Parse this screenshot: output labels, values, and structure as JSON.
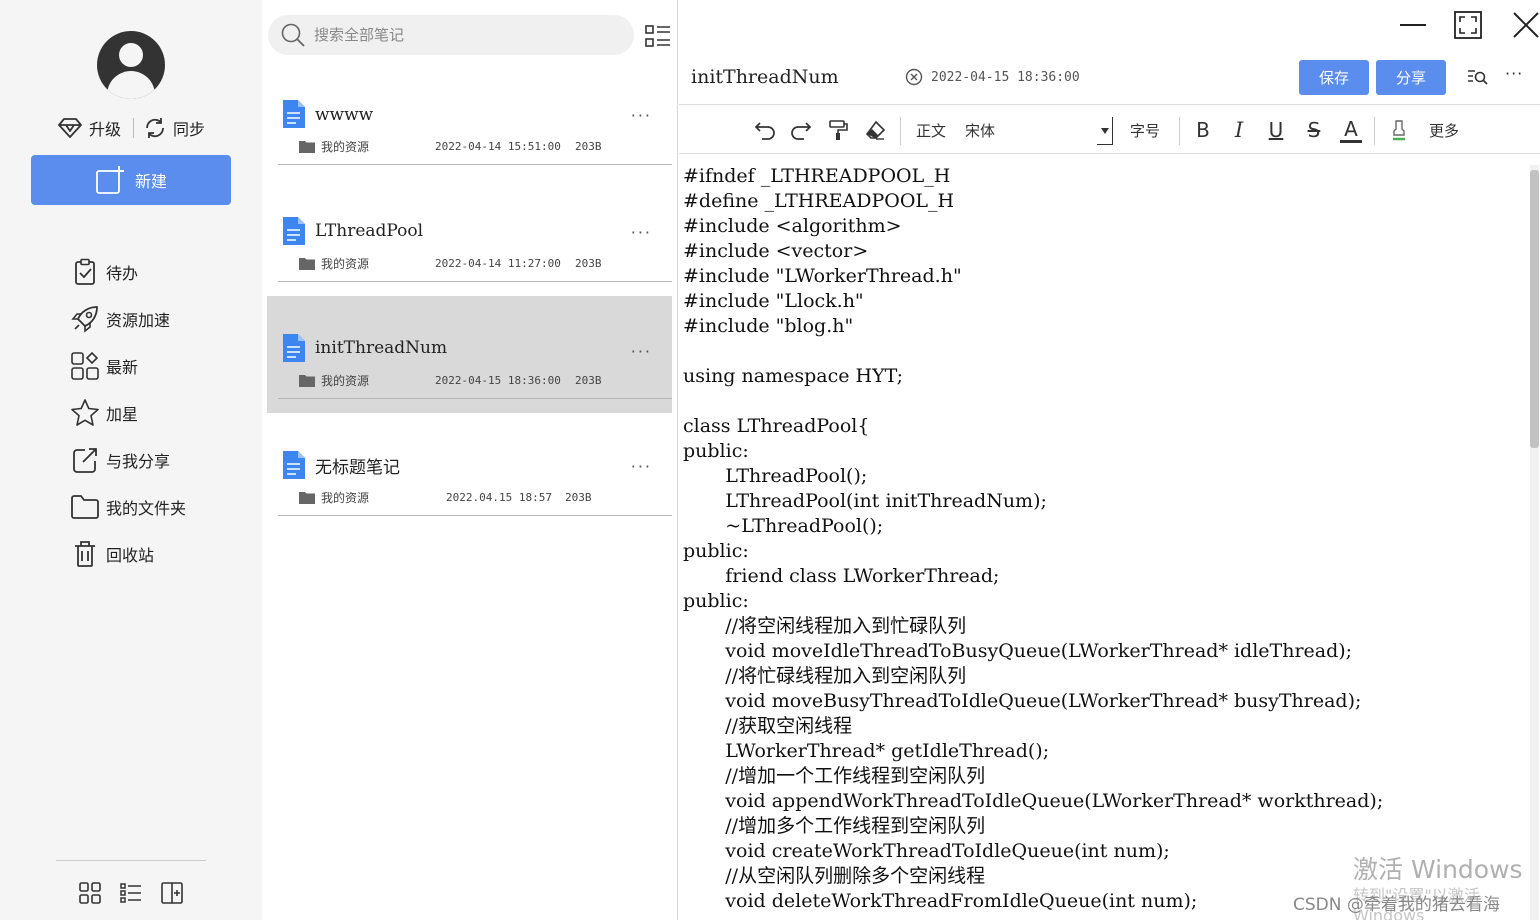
{
  "sidebar": {
    "upgrade_label": "升级",
    "sync_label": "同步",
    "new_label": "新建",
    "items": [
      {
        "label": "待办",
        "icon": "todo-clipboard-icon"
      },
      {
        "label": "资源加速",
        "icon": "rocket-icon"
      },
      {
        "label": "最新",
        "icon": "grid-recent-icon"
      },
      {
        "label": "加星",
        "icon": "star-icon"
      },
      {
        "label": "与我分享",
        "icon": "shared-with-me-icon"
      },
      {
        "label": "我的文件夹",
        "icon": "folder-icon"
      },
      {
        "label": "回收站",
        "icon": "trash-icon"
      }
    ]
  },
  "search": {
    "placeholder": "搜索全部笔记"
  },
  "notes": [
    {
      "title": "wwww",
      "folder": "我的资源",
      "date": "2022-04-14 15:51:00",
      "size": "203B"
    },
    {
      "title": "LThreadPool",
      "folder": "我的资源",
      "date": "2022-04-14 11:27:00",
      "size": "203B"
    },
    {
      "title": "initThreadNum",
      "folder": "我的资源",
      "date": "2022-04-15 18:36:00",
      "size": "203B",
      "selected": true
    },
    {
      "title": "无标题笔记",
      "folder": "我的资源",
      "date": "2022.04.15 18:57",
      "size": "203B"
    }
  ],
  "editor": {
    "title": "initThreadNum",
    "time": "2022-04-15 18:36:00",
    "save_label": "保存",
    "share_label": "分享",
    "more_label": "···",
    "toolbar": {
      "style": "正文",
      "font": "宋体",
      "size_label": "字号",
      "bold": "B",
      "italic": "I",
      "underline": "U",
      "strike": "S",
      "font_color": "A",
      "more": "更多"
    },
    "code_lines": [
      "#ifndef _LTHREADPOOL_H",
      "#define _LTHREADPOOL_H",
      "#include <algorithm>",
      "#include <vector>",
      "#include \"LWorkerThread.h\"",
      "#include \"Llock.h\"",
      "#include \"blog.h\"",
      "",
      "using namespace HYT;",
      "",
      "class LThreadPool{",
      "public:",
      "       LThreadPool();",
      "       LThreadPool(int initThreadNum);",
      "       ~LThreadPool();",
      "public:",
      "       friend class LWorkerThread;",
      "public:",
      "       //将空闲线程加入到忙碌队列",
      "       void moveIdleThreadToBusyQueue(LWorkerThread* idleThread);",
      "       //将忙碌线程加入到空闲队列",
      "       void moveBusyThreadToIdleQueue(LWorkerThread* busyThread);",
      "       //获取空闲线程",
      "       LWorkerThread* getIdleThread();",
      "       //增加一个工作线程到空闲队列",
      "       void appendWorkThreadToIdleQueue(LWorkerThread* workthread);",
      "       //增加多个工作线程到空闲队列",
      "       void createWorkThreadToIdleQueue(int num);",
      "       //从空闲队列删除多个空闲线程",
      "       void deleteWorkThreadFromIdleQueue(int num);"
    ]
  },
  "overlay": {
    "activate": "激活 Windows",
    "activate_sub": "转到\"设置\"以激活 Windows",
    "csdn": "CSDN @牵着我的猪去看海"
  },
  "colors": {
    "accent": "#5b8def",
    "selected_row": "#d9d9d9"
  }
}
